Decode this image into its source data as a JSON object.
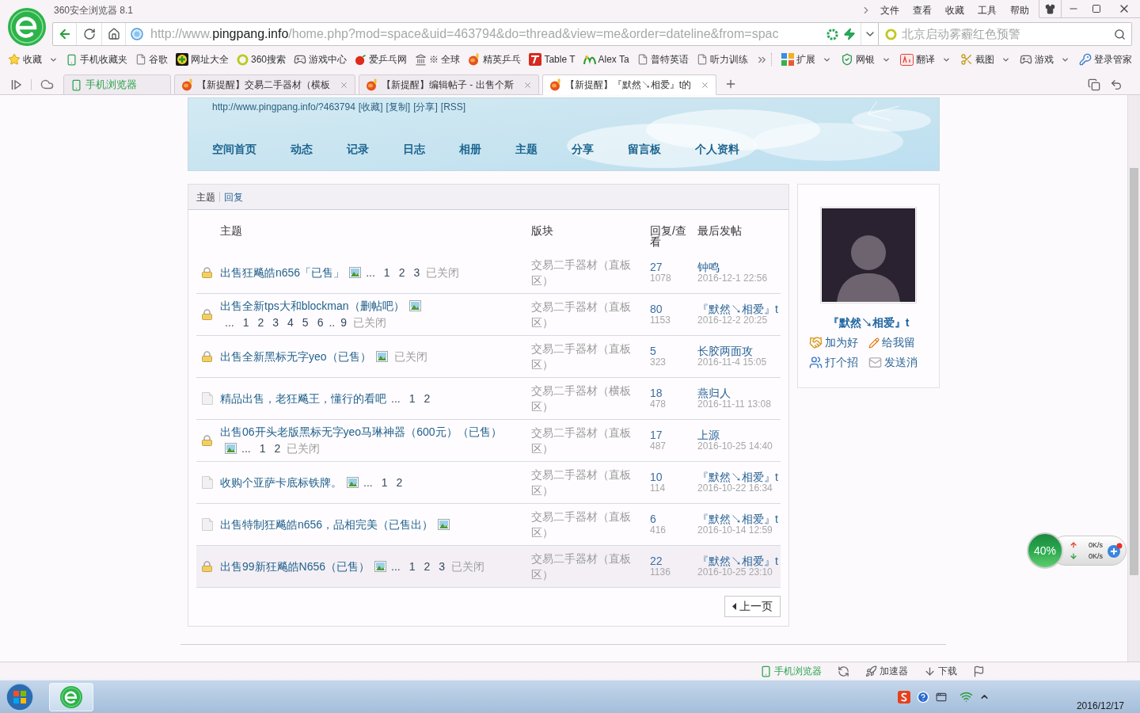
{
  "window": {
    "title": "360安全浏览器 8.1",
    "menu": [
      "文件",
      "查看",
      "收藏",
      "工具",
      "帮助"
    ]
  },
  "address_bar": {
    "url_scheme": "http://www.",
    "url_domain": "pingpang.info",
    "url_path": "/home.php?mod=space&uid=463794&do=thread&view=me&order=dateline&from=spac"
  },
  "search": {
    "placeholder": "北京启动雾霾红色预警"
  },
  "bookmarks": [
    {
      "label": "收藏",
      "kind": "star",
      "dropdown": true
    },
    {
      "label": "手机收藏夹",
      "kind": "phone",
      "dropdown": false
    },
    {
      "label": "谷歌",
      "kind": "page",
      "dropdown": false
    },
    {
      "label": "网址大全",
      "kind": "plus",
      "dropdown": false
    },
    {
      "label": "360搜索",
      "kind": "ring",
      "dropdown": false
    },
    {
      "label": "游戏中心",
      "kind": "gamepad",
      "dropdown": false
    },
    {
      "label": "爱乒乓网",
      "kind": "ball",
      "dropdown": false
    },
    {
      "label": "※ 全球",
      "kind": "tower",
      "dropdown": false
    },
    {
      "label": "精英乒乓",
      "kind": "paddle",
      "dropdown": false
    },
    {
      "label": "Table T",
      "kind": "tile",
      "dropdown": false
    },
    {
      "label": "Alex Ta",
      "kind": "sprout",
      "dropdown": false
    },
    {
      "label": "普特英语",
      "kind": "page",
      "dropdown": false
    },
    {
      "label": "听力训练",
      "kind": "page",
      "dropdown": false
    }
  ],
  "tools": [
    {
      "label": "扩展",
      "kind": "grid",
      "dropdown": true
    },
    {
      "label": "网银",
      "kind": "shield",
      "dropdown": true
    },
    {
      "label": "翻译",
      "kind": "dictionary",
      "dropdown": true
    },
    {
      "label": "截图",
      "kind": "scissors",
      "dropdown": true
    },
    {
      "label": "游戏",
      "kind": "gamepad",
      "dropdown": true
    },
    {
      "label": "登录管家",
      "kind": "key",
      "dropdown": false
    }
  ],
  "tabs": [
    {
      "label": "手机浏览器",
      "kind": "mobile",
      "selected": false
    },
    {
      "label": "【新提醒】交易二手器材（横板",
      "kind": "page",
      "selected": false
    },
    {
      "label": "【新提醒】编辑帖子 - 出售个斯",
      "kind": "page",
      "selected": false
    },
    {
      "label": "【新提醒】『默然↘相爱』t的",
      "kind": "page",
      "selected": true
    }
  ],
  "page": {
    "space_url": "http://www.pingpang.info/?463794",
    "space_links": [
      "[收藏]",
      "[复制]",
      "[分享]",
      "[RSS]"
    ],
    "nav": [
      "空间首页",
      "动态",
      "记录",
      "日志",
      "相册",
      "主题",
      "分享",
      "留言板",
      "个人资料"
    ],
    "subtabs": [
      {
        "label": "主题",
        "selected": true
      },
      {
        "label": "回复",
        "selected": false
      }
    ],
    "columns": [
      "主题",
      "版块",
      "回复/查看",
      "最后发帖"
    ],
    "threads": [
      {
        "subject": "出售狂飚皓n656「已售」",
        "locked": true,
        "attachment": true,
        "more": "...",
        "pages": [
          {
            "label": "1",
            "kind": "link"
          },
          {
            "label": "2",
            "kind": "link"
          },
          {
            "label": "3",
            "kind": "link"
          }
        ],
        "closed": "已关闭",
        "forum": "交易二手器材（直板区）",
        "replies": "27",
        "views": "1078",
        "last_author": "钟鸣",
        "last_time": "2016-12-1 22:56",
        "selected": false
      },
      {
        "subject": "出售全新tps大和blockman（删帖吧）",
        "locked": true,
        "attachment": true,
        "more": "...",
        "pages": [
          {
            "label": "1",
            "kind": "link"
          },
          {
            "label": "2",
            "kind": "link"
          },
          {
            "label": "3",
            "kind": "link"
          },
          {
            "label": "4",
            "kind": "link"
          },
          {
            "label": "5",
            "kind": "link"
          },
          {
            "label": "6",
            "kind": "link"
          },
          {
            "label": "..",
            "kind": "gap"
          },
          {
            "label": "9",
            "kind": "link"
          }
        ],
        "closed": "已关闭",
        "forum": "交易二手器材（直板区）",
        "replies": "80",
        "views": "1153",
        "last_author": "『默然↘相爱』t",
        "last_time": "2016-12-2 20:25",
        "selected": false
      },
      {
        "subject": "出售全新黑标无字yeo（已售）",
        "locked": true,
        "attachment": true,
        "closed": "已关闭",
        "forum": "交易二手器材（直板区）",
        "replies": "5",
        "views": "323",
        "last_author": "长胶两面攻",
        "last_time": "2016-11-4 15:05",
        "selected": false
      },
      {
        "subject": "精品出售，老狂飚王，懂行的看吧",
        "locked": false,
        "attachment": false,
        "more": "...",
        "pages": [
          {
            "label": "1",
            "kind": "link"
          },
          {
            "label": "2",
            "kind": "link"
          }
        ],
        "forum": "交易二手器材（横板区）",
        "replies": "18",
        "views": "478",
        "last_author": "燕归人",
        "last_time": "2016-11-11 13:08",
        "selected": false
      },
      {
        "subject": "出售06开头老版黑标无字yeo马琳神器（600元）（已售）",
        "locked": true,
        "attachment": true,
        "more": "...",
        "pages": [
          {
            "label": "1",
            "kind": "link"
          },
          {
            "label": "2",
            "kind": "link"
          }
        ],
        "closed": "已关闭",
        "forum": "交易二手器材（直板区）",
        "replies": "17",
        "views": "487",
        "last_author": "上源",
        "last_time": "2016-10-25 14:40",
        "selected": false
      },
      {
        "subject": "收购个亚萨卡底标铁牌。",
        "locked": false,
        "attachment": true,
        "more": "...",
        "pages": [
          {
            "label": "1",
            "kind": "link"
          },
          {
            "label": "2",
            "kind": "link"
          }
        ],
        "forum": "交易二手器材（直板区）",
        "replies": "10",
        "views": "114",
        "last_author": "『默然↘相爱』t",
        "last_time": "2016-10-22 16:34",
        "selected": false
      },
      {
        "subject": "出售特制狂飚皓n656，品相完美（已售出）",
        "locked": false,
        "attachment": true,
        "forum": "交易二手器材（直板区）",
        "replies": "6",
        "views": "416",
        "last_author": "『默然↘相爱』t",
        "last_time": "2016-10-14 12:59",
        "selected": false
      },
      {
        "subject": "出售99新狂飚皓N656（已售）",
        "locked": true,
        "attachment": true,
        "more": "...",
        "pages": [
          {
            "label": "1",
            "kind": "link"
          },
          {
            "label": "2",
            "kind": "link"
          },
          {
            "label": "3",
            "kind": "link"
          }
        ],
        "closed": "已关闭",
        "forum": "交易二手器材（直板区）",
        "replies": "22",
        "views": "1136",
        "last_author": "『默然↘相爱』t",
        "last_time": "2016-10-25 23:10",
        "selected": true
      }
    ],
    "prev_page": "上一页"
  },
  "profile": {
    "name": "『默然↘相爱』t",
    "actions": [
      {
        "label": "加为好",
        "kind": "friend"
      },
      {
        "label": "给我留",
        "kind": "note"
      },
      {
        "label": "打个招",
        "kind": "greet"
      },
      {
        "label": "发送消",
        "kind": "mail"
      }
    ]
  },
  "memory_widget": {
    "reading": "40%",
    "upload": "0K/s",
    "download": "0K/s"
  },
  "status_bar": {
    "items": [
      {
        "kind": "mobile",
        "label": "手机浏览器"
      },
      {
        "kind": "refresh"
      },
      {
        "kind": "rocket",
        "label": "加速器"
      },
      {
        "kind": "download",
        "label": "下载"
      },
      {
        "kind": "flag"
      }
    ]
  },
  "taskbar": {
    "date": "2016/12/17"
  }
}
